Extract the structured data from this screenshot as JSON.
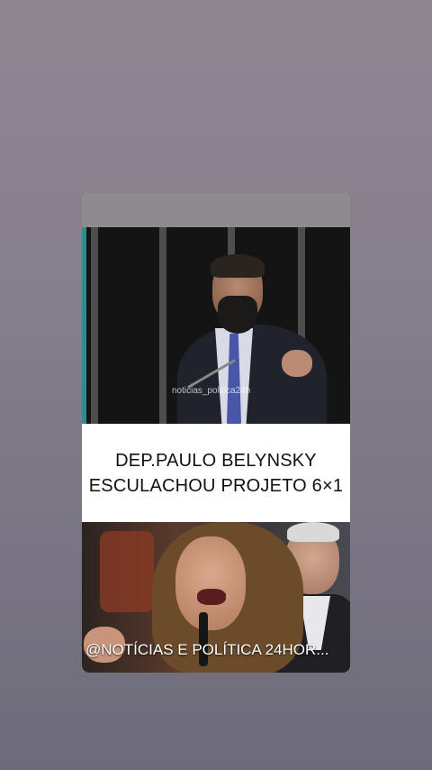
{
  "post": {
    "watermark": "noticias_politica24h",
    "headline": "DEP.PAULO BELYNSKY ESCULACHOU PROJETO 6×1",
    "overlay_handle": "@NOTÍCIAS E POLÍTICA 24HOR..."
  }
}
